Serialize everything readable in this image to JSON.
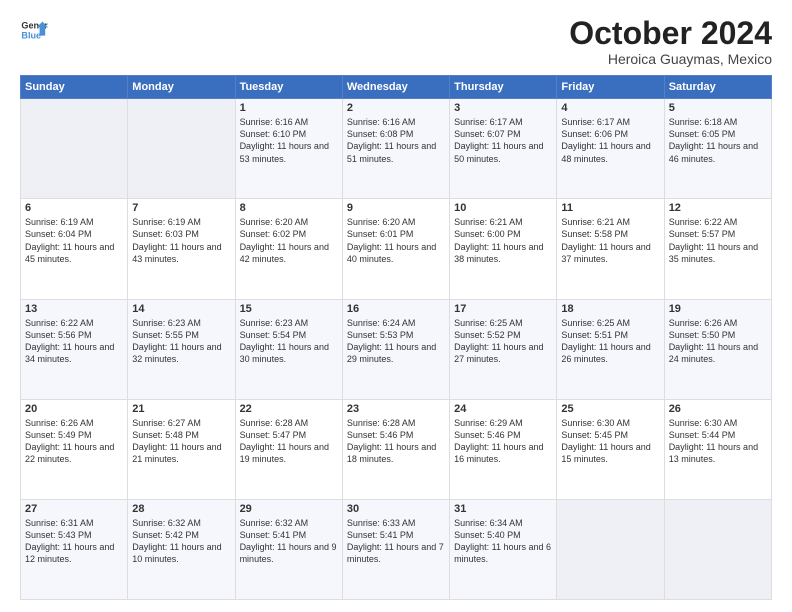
{
  "header": {
    "logo_line1": "General",
    "logo_line2": "Blue",
    "month": "October 2024",
    "location": "Heroica Guaymas, Mexico"
  },
  "weekdays": [
    "Sunday",
    "Monday",
    "Tuesday",
    "Wednesday",
    "Thursday",
    "Friday",
    "Saturday"
  ],
  "weeks": [
    [
      {
        "day": "",
        "sunrise": "",
        "sunset": "",
        "daylight": ""
      },
      {
        "day": "",
        "sunrise": "",
        "sunset": "",
        "daylight": ""
      },
      {
        "day": "1",
        "sunrise": "Sunrise: 6:16 AM",
        "sunset": "Sunset: 6:10 PM",
        "daylight": "Daylight: 11 hours and 53 minutes."
      },
      {
        "day": "2",
        "sunrise": "Sunrise: 6:16 AM",
        "sunset": "Sunset: 6:08 PM",
        "daylight": "Daylight: 11 hours and 51 minutes."
      },
      {
        "day": "3",
        "sunrise": "Sunrise: 6:17 AM",
        "sunset": "Sunset: 6:07 PM",
        "daylight": "Daylight: 11 hours and 50 minutes."
      },
      {
        "day": "4",
        "sunrise": "Sunrise: 6:17 AM",
        "sunset": "Sunset: 6:06 PM",
        "daylight": "Daylight: 11 hours and 48 minutes."
      },
      {
        "day": "5",
        "sunrise": "Sunrise: 6:18 AM",
        "sunset": "Sunset: 6:05 PM",
        "daylight": "Daylight: 11 hours and 46 minutes."
      }
    ],
    [
      {
        "day": "6",
        "sunrise": "Sunrise: 6:19 AM",
        "sunset": "Sunset: 6:04 PM",
        "daylight": "Daylight: 11 hours and 45 minutes."
      },
      {
        "day": "7",
        "sunrise": "Sunrise: 6:19 AM",
        "sunset": "Sunset: 6:03 PM",
        "daylight": "Daylight: 11 hours and 43 minutes."
      },
      {
        "day": "8",
        "sunrise": "Sunrise: 6:20 AM",
        "sunset": "Sunset: 6:02 PM",
        "daylight": "Daylight: 11 hours and 42 minutes."
      },
      {
        "day": "9",
        "sunrise": "Sunrise: 6:20 AM",
        "sunset": "Sunset: 6:01 PM",
        "daylight": "Daylight: 11 hours and 40 minutes."
      },
      {
        "day": "10",
        "sunrise": "Sunrise: 6:21 AM",
        "sunset": "Sunset: 6:00 PM",
        "daylight": "Daylight: 11 hours and 38 minutes."
      },
      {
        "day": "11",
        "sunrise": "Sunrise: 6:21 AM",
        "sunset": "Sunset: 5:58 PM",
        "daylight": "Daylight: 11 hours and 37 minutes."
      },
      {
        "day": "12",
        "sunrise": "Sunrise: 6:22 AM",
        "sunset": "Sunset: 5:57 PM",
        "daylight": "Daylight: 11 hours and 35 minutes."
      }
    ],
    [
      {
        "day": "13",
        "sunrise": "Sunrise: 6:22 AM",
        "sunset": "Sunset: 5:56 PM",
        "daylight": "Daylight: 11 hours and 34 minutes."
      },
      {
        "day": "14",
        "sunrise": "Sunrise: 6:23 AM",
        "sunset": "Sunset: 5:55 PM",
        "daylight": "Daylight: 11 hours and 32 minutes."
      },
      {
        "day": "15",
        "sunrise": "Sunrise: 6:23 AM",
        "sunset": "Sunset: 5:54 PM",
        "daylight": "Daylight: 11 hours and 30 minutes."
      },
      {
        "day": "16",
        "sunrise": "Sunrise: 6:24 AM",
        "sunset": "Sunset: 5:53 PM",
        "daylight": "Daylight: 11 hours and 29 minutes."
      },
      {
        "day": "17",
        "sunrise": "Sunrise: 6:25 AM",
        "sunset": "Sunset: 5:52 PM",
        "daylight": "Daylight: 11 hours and 27 minutes."
      },
      {
        "day": "18",
        "sunrise": "Sunrise: 6:25 AM",
        "sunset": "Sunset: 5:51 PM",
        "daylight": "Daylight: 11 hours and 26 minutes."
      },
      {
        "day": "19",
        "sunrise": "Sunrise: 6:26 AM",
        "sunset": "Sunset: 5:50 PM",
        "daylight": "Daylight: 11 hours and 24 minutes."
      }
    ],
    [
      {
        "day": "20",
        "sunrise": "Sunrise: 6:26 AM",
        "sunset": "Sunset: 5:49 PM",
        "daylight": "Daylight: 11 hours and 22 minutes."
      },
      {
        "day": "21",
        "sunrise": "Sunrise: 6:27 AM",
        "sunset": "Sunset: 5:48 PM",
        "daylight": "Daylight: 11 hours and 21 minutes."
      },
      {
        "day": "22",
        "sunrise": "Sunrise: 6:28 AM",
        "sunset": "Sunset: 5:47 PM",
        "daylight": "Daylight: 11 hours and 19 minutes."
      },
      {
        "day": "23",
        "sunrise": "Sunrise: 6:28 AM",
        "sunset": "Sunset: 5:46 PM",
        "daylight": "Daylight: 11 hours and 18 minutes."
      },
      {
        "day": "24",
        "sunrise": "Sunrise: 6:29 AM",
        "sunset": "Sunset: 5:46 PM",
        "daylight": "Daylight: 11 hours and 16 minutes."
      },
      {
        "day": "25",
        "sunrise": "Sunrise: 6:30 AM",
        "sunset": "Sunset: 5:45 PM",
        "daylight": "Daylight: 11 hours and 15 minutes."
      },
      {
        "day": "26",
        "sunrise": "Sunrise: 6:30 AM",
        "sunset": "Sunset: 5:44 PM",
        "daylight": "Daylight: 11 hours and 13 minutes."
      }
    ],
    [
      {
        "day": "27",
        "sunrise": "Sunrise: 6:31 AM",
        "sunset": "Sunset: 5:43 PM",
        "daylight": "Daylight: 11 hours and 12 minutes."
      },
      {
        "day": "28",
        "sunrise": "Sunrise: 6:32 AM",
        "sunset": "Sunset: 5:42 PM",
        "daylight": "Daylight: 11 hours and 10 minutes."
      },
      {
        "day": "29",
        "sunrise": "Sunrise: 6:32 AM",
        "sunset": "Sunset: 5:41 PM",
        "daylight": "Daylight: 11 hours and 9 minutes."
      },
      {
        "day": "30",
        "sunrise": "Sunrise: 6:33 AM",
        "sunset": "Sunset: 5:41 PM",
        "daylight": "Daylight: 11 hours and 7 minutes."
      },
      {
        "day": "31",
        "sunrise": "Sunrise: 6:34 AM",
        "sunset": "Sunset: 5:40 PM",
        "daylight": "Daylight: 11 hours and 6 minutes."
      },
      {
        "day": "",
        "sunrise": "",
        "sunset": "",
        "daylight": ""
      },
      {
        "day": "",
        "sunrise": "",
        "sunset": "",
        "daylight": ""
      }
    ]
  ]
}
